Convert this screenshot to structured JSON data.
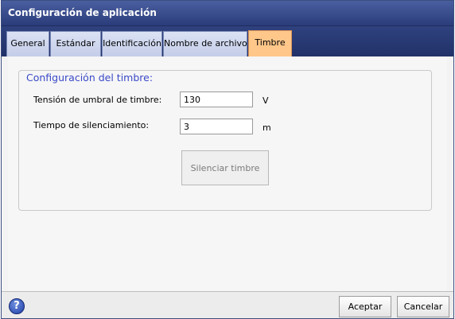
{
  "window": {
    "title": "Configuración de aplicación"
  },
  "tabs": [
    {
      "label": "General",
      "active": false
    },
    {
      "label": "Estándar",
      "active": false
    },
    {
      "label": "Identificación",
      "active": false
    },
    {
      "label": "Nombre de archivo",
      "active": false
    },
    {
      "label": "Timbre",
      "active": true
    }
  ],
  "ringer": {
    "group_title": "Configuración del timbre:",
    "threshold_label": "Tensión de umbral de timbre:",
    "threshold_value": "130",
    "threshold_unit": "V",
    "silence_label": "Tiempo de silenciamiento:",
    "silence_value": "3",
    "silence_unit": "m",
    "mute_button": "Silenciar timbre"
  },
  "footer": {
    "help_icon": "help-icon",
    "help_glyph": "?",
    "ok_label": "Aceptar",
    "cancel_label": "Cancelar"
  },
  "colors": {
    "titlebar": "#2b3c7a",
    "active_tab": "#ffc78a",
    "group_title": "#3a49c8"
  }
}
